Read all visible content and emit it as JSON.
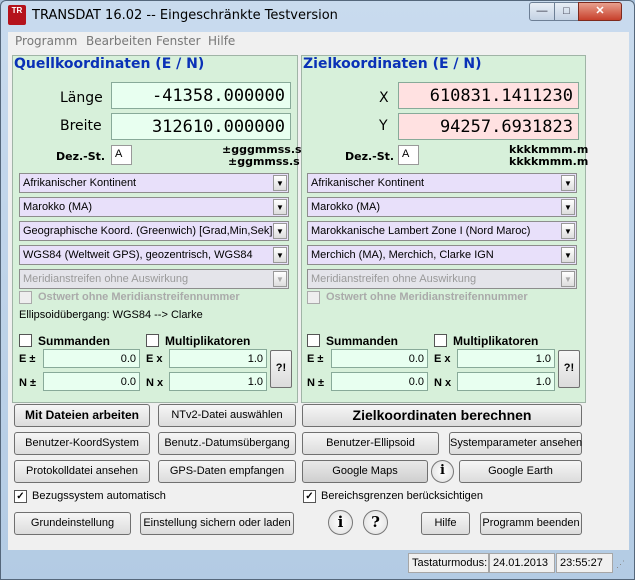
{
  "window": {
    "title": "TRANSDAT 16.02 -- Eingeschränkte Testversion",
    "logo_top": "KOLART",
    "logo_main": "TR",
    "logo_bottom": "SOFT",
    "min": "—",
    "max": "□",
    "close": "✕"
  },
  "menu": [
    "Programm",
    "Bearbeiten",
    "Fenster",
    "Hilfe"
  ],
  "source": {
    "title": "Quellkoordinaten (E / N)",
    "label1": "Länge",
    "value1": "-41358.000000",
    "label2": "Breite",
    "value2": "312610.000000",
    "dez_label": "Dez.-St.",
    "dez_value": "A",
    "format1": "±gggmmss.s",
    "format2": "±ggmmss.s",
    "selects": [
      "Afrikanischer Kontinent",
      "Marokko (MA)",
      "Geographische Koord. (Greenwich) [Grad,Min,Sek]",
      "WGS84 (Weltweit GPS), geozentrisch, WGS84",
      "Meridianstreifen ohne Auswirkung"
    ],
    "ostwert_label": "Ostwert ohne Meridianstreifennummer",
    "ellipsoid_text": "Ellipsoidübergang: WGS84 --> Clarke",
    "summanden": "Summanden",
    "multiplikatoren": "Multiplikatoren",
    "e_pm": "E ±",
    "n_pm": "N ±",
    "e_x": "E x",
    "n_x": "N x",
    "e_sum": "0.0",
    "n_sum": "0.0",
    "e_mul": "1.0",
    "n_mul": "1.0",
    "help": "?!"
  },
  "target": {
    "title": "Zielkoordinaten (E / N)",
    "label1": "X",
    "value1": "610831.1411230",
    "label2": "Y",
    "value2": "94257.6931823",
    "dez_label": "Dez.-St.",
    "dez_value": "A",
    "format1": "kkkkmmm.m",
    "format2": "kkkkmmm.m",
    "selects": [
      "Afrikanischer Kontinent",
      "Marokko (MA)",
      "Marokkanische Lambert Zone I (Nord Maroc)",
      "Merchich (MA), Merchich, Clarke IGN",
      "Meridianstreifen ohne Auswirkung"
    ],
    "ostwert_label": "Ostwert ohne Meridianstreifennummer",
    "summanden": "Summanden",
    "multiplikatoren": "Multiplikatoren",
    "e_pm": "E ±",
    "n_pm": "N ±",
    "e_x": "E x",
    "n_x": "N x",
    "e_sum": "0.0",
    "n_sum": "0.0",
    "e_mul": "1.0",
    "n_mul": "1.0",
    "help": "?!"
  },
  "buttons": {
    "dateien": "Mit Dateien arbeiten",
    "ntv2": "NTv2-Datei auswählen",
    "berechnen": "Zielkoordinaten berechnen",
    "koordsystem": "Benutzer-KoordSystem",
    "datum": "Benutz.-Datumsübergang",
    "ellipsoid": "Benutzer-Ellipsoid",
    "systemparameter": "Systemparameter ansehen",
    "protokoll": "Protokolldatei ansehen",
    "gps": "GPS-Daten empfangen",
    "gmaps": "Google Maps",
    "info": "i",
    "gearth": "Google Earth",
    "grundeinstellung": "Grundeinstellung",
    "sichern": "Einstellung sichern oder laden",
    "info2": "i",
    "question": "?",
    "hilfe": "Hilfe",
    "beenden": "Programm beenden"
  },
  "checks": {
    "bezugssystem": "Bezugssystem automatisch",
    "bereichsgrenzen": "Bereichsgrenzen berücksichtigen",
    "checkmark": "✓",
    "arrow": "▼"
  },
  "status": {
    "mode": "Tastaturmodus:",
    "date": "24.01.2013",
    "time": "23:55:27",
    "grip": "⋰"
  }
}
